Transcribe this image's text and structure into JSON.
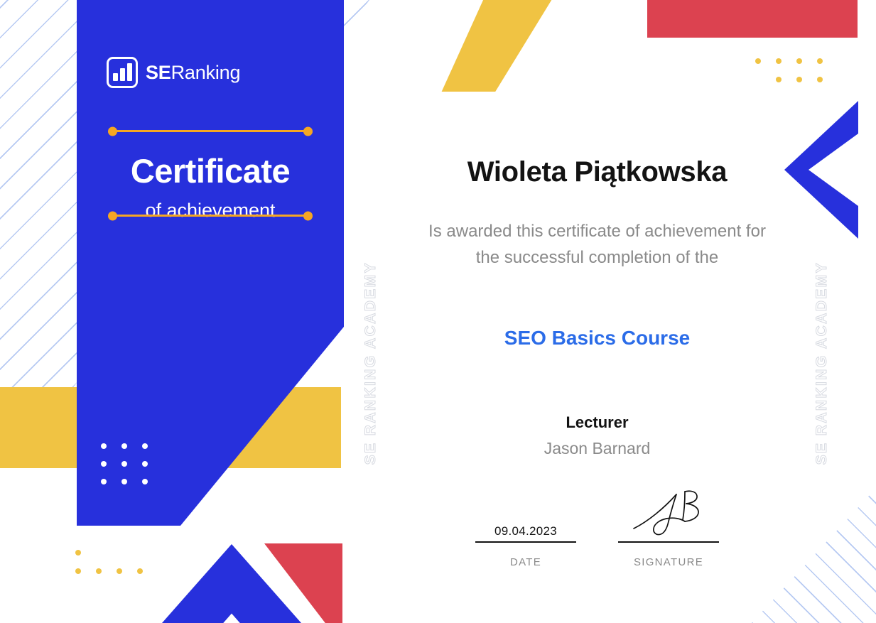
{
  "document": {
    "type": "certificate-of-achievement",
    "issuer": "SE Ranking Academy"
  },
  "brand": {
    "logo_icon": "bar-chart-logo-icon",
    "logo_bold": "SE",
    "logo_regular": "Ranking",
    "colors": {
      "blue": "#2730dc",
      "yellow": "#f0c343",
      "red": "#dc4250",
      "orange": "#f5a623",
      "link_blue": "#2b6ce8",
      "stripe_blue": "#aac0f0",
      "muted_text": "#8a8a8a",
      "dark_text": "#131313",
      "watermark": "#d6d9e0"
    }
  },
  "left_panel": {
    "title": "Certificate",
    "subtitle": "of achievement"
  },
  "watermark": {
    "text": "SE RANKING ACADEMY"
  },
  "main": {
    "recipient_name": "Wioleta Piątkowska",
    "awarded_text": "Is awarded this certificate of achievement for the successful completion of the",
    "course_title": "SEO Basics Course",
    "lecturer_label": "Lecturer",
    "lecturer_name": "Jason Barnard"
  },
  "footer": {
    "date": {
      "value": "09.04.2023",
      "caption": "DATE"
    },
    "signature": {
      "value": "",
      "caption": "SIGNATURE",
      "icon": "handwritten-signature-icon"
    }
  }
}
